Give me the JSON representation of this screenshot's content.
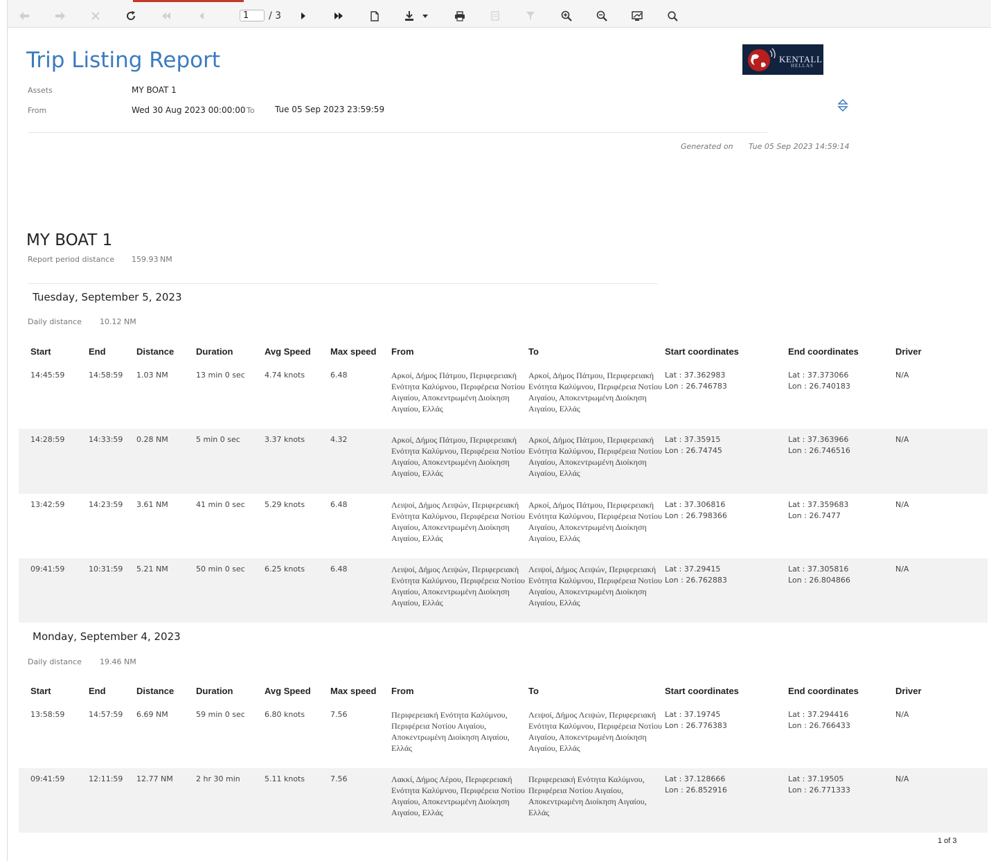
{
  "toolbar": {
    "page_current": "1",
    "page_total": "/ 3",
    "buttons": [
      "back-icon",
      "forward-icon",
      "stop-icon",
      "refresh-icon",
      "first-page-icon",
      "previous-page-icon",
      "next-page-icon",
      "last-page-icon",
      "document-icon",
      "download-icon",
      "print-icon",
      "save-icon",
      "filter-icon",
      "zoom-in-icon",
      "zoom-out-icon",
      "fullscreen-icon",
      "search-icon"
    ]
  },
  "header": {
    "title": "Trip Listing Report",
    "logo_text": "KENTALL",
    "logo_sub": "HELLAS",
    "assets_label": "Assets",
    "assets_value": "MY BOAT 1",
    "from_label": "From",
    "from_value": "Wed 30 Aug 2023 00:00:00",
    "to_label": "To",
    "to_value": "Tue 05 Sep 2023 23:59:59",
    "generated_label": "Generated on",
    "generated_value": "Tue 05 Sep 2023 14:59:14"
  },
  "asset": {
    "name": "MY BOAT 1",
    "distance_label": "Report period distance",
    "distance_value": "159.93",
    "distance_unit": "NM"
  },
  "columns": [
    "Start",
    "End",
    "Distance",
    "Duration",
    "Avg Speed",
    "Max speed",
    "From",
    "To",
    "Start coordinates",
    "End coordinates",
    "Driver"
  ],
  "days": [
    {
      "title": "Tuesday, September 5, 2023",
      "distance_label": "Daily distance",
      "distance_value": "10.12",
      "distance_unit": "NM",
      "trips": [
        {
          "start": "14:45:59",
          "end": "14:58:59",
          "distance": "1.03 NM",
          "duration": "13 min 0 sec",
          "avg": "4.74 knots",
          "max": "6.48",
          "from": "Αρκοί, Δήμος Πάτμου, Περιφερειακή Ενότητα Καλύμνου, Περιφέρεια Νοτίου Αιγαίου, Αποκεντρωμένη Διοίκηση Αιγαίου, Ελλάς",
          "to": "Αρκοί, Δήμος Πάτμου, Περιφερειακή Ενότητα Καλύμνου, Περιφέρεια Νοτίου Αιγαίου, Αποκεντρωμένη Διοίκηση Αιγαίου, Ελλάς",
          "start_lat": "Lat : 37.362983",
          "start_lon": "Lon : 26.746783",
          "end_lat": "Lat : 37.373066",
          "end_lon": "Lon : 26.740183",
          "driver": "N/A"
        },
        {
          "start": "14:28:59",
          "end": "14:33:59",
          "distance": "0.28 NM",
          "duration": "5 min 0 sec",
          "avg": "3.37 knots",
          "max": "4.32",
          "from": "Αρκοί, Δήμος Πάτμου, Περιφερειακή Ενότητα Καλύμνου, Περιφέρεια Νοτίου Αιγαίου, Αποκεντρωμένη Διοίκηση Αιγαίου, Ελλάς",
          "to": "Αρκοί, Δήμος Πάτμου, Περιφερειακή Ενότητα Καλύμνου, Περιφέρεια Νοτίου Αιγαίου, Αποκεντρωμένη Διοίκηση Αιγαίου, Ελλάς",
          "start_lat": "Lat : 37.35915",
          "start_lon": "Lon : 26.74745",
          "end_lat": "Lat : 37.363966",
          "end_lon": "Lon : 26.746516",
          "driver": "N/A"
        },
        {
          "start": "13:42:59",
          "end": "14:23:59",
          "distance": "3.61 NM",
          "duration": "41 min 0 sec",
          "avg": "5.29 knots",
          "max": "6.48",
          "from": "Λειψοί, Δήμος Λειψών, Περιφερειακή Ενότητα Καλύμνου, Περιφέρεια Νοτίου Αιγαίου, Αποκεντρωμένη Διοίκηση Αιγαίου, Ελλάς",
          "to": "Αρκοί, Δήμος Πάτμου, Περιφερειακή Ενότητα Καλύμνου, Περιφέρεια Νοτίου Αιγαίου, Αποκεντρωμένη Διοίκηση Αιγαίου, Ελλάς",
          "start_lat": "Lat : 37.306816",
          "start_lon": "Lon : 26.798366",
          "end_lat": "Lat : 37.359683",
          "end_lon": "Lon : 26.7477",
          "driver": "N/A"
        },
        {
          "start": "09:41:59",
          "end": "10:31:59",
          "distance": "5.21 NM",
          "duration": "50 min 0 sec",
          "avg": "6.25 knots",
          "max": "6.48",
          "from": "Λειψοί, Δήμος Λειψών, Περιφερειακή Ενότητα Καλύμνου, Περιφέρεια Νοτίου Αιγαίου, Αποκεντρωμένη Διοίκηση Αιγαίου, Ελλάς",
          "to": "Λειψοί, Δήμος Λειψών, Περιφερειακή Ενότητα Καλύμνου, Περιφέρεια Νοτίου Αιγαίου, Αποκεντρωμένη Διοίκηση Αιγαίου, Ελλάς",
          "start_lat": "Lat : 37.29415",
          "start_lon": "Lon : 26.762883",
          "end_lat": "Lat : 37.305816",
          "end_lon": "Lon : 26.804866",
          "driver": "N/A"
        }
      ]
    },
    {
      "title": "Monday, September 4, 2023",
      "distance_label": "Daily distance",
      "distance_value": "19.46",
      "distance_unit": "NM",
      "trips": [
        {
          "start": "13:58:59",
          "end": "14:57:59",
          "distance": "6.69 NM",
          "duration": "59 min 0 sec",
          "avg": "6.80 knots",
          "max": "7.56",
          "from": "Περιφερειακή Ενότητα Καλύμνου, Περιφέρεια Νοτίου Αιγαίου, Αποκεντρωμένη Διοίκηση Αιγαίου, Ελλάς",
          "to": "Λειψοί, Δήμος Λειψών, Περιφερειακή Ενότητα Καλύμνου, Περιφέρεια Νοτίου Αιγαίου, Αποκεντρωμένη Διοίκηση Αιγαίου, Ελλάς",
          "start_lat": "Lat : 37.19745",
          "start_lon": "Lon : 26.776383",
          "end_lat": "Lat : 37.294416",
          "end_lon": "Lon : 26.766433",
          "driver": "N/A"
        },
        {
          "start": "09:41:59",
          "end": "12:11:59",
          "distance": "12.77 NM",
          "duration": "2 hr 30 min",
          "avg": "5.11 knots",
          "max": "7.56",
          "from": "Λακκί, Δήμος Λέρου, Περιφερειακή Ενότητα Καλύμνου, Περιφέρεια Νοτίου Αιγαίου, Αποκεντρωμένη Διοίκηση Αιγαίου, Ελλάς",
          "to": "Περιφερειακή Ενότητα Καλύμνου, Περιφέρεια Νοτίου Αιγαίου, Αποκεντρωμένη Διοίκηση Αιγαίου, Ελλάς",
          "start_lat": "Lat : 37.128666",
          "start_lon": "Lon : 26.852916",
          "end_lat": "Lat : 37.19505",
          "end_lon": "Lon : 26.771333",
          "driver": "N/A"
        }
      ]
    }
  ],
  "footer": {
    "page_indicator": "1 of 3"
  }
}
